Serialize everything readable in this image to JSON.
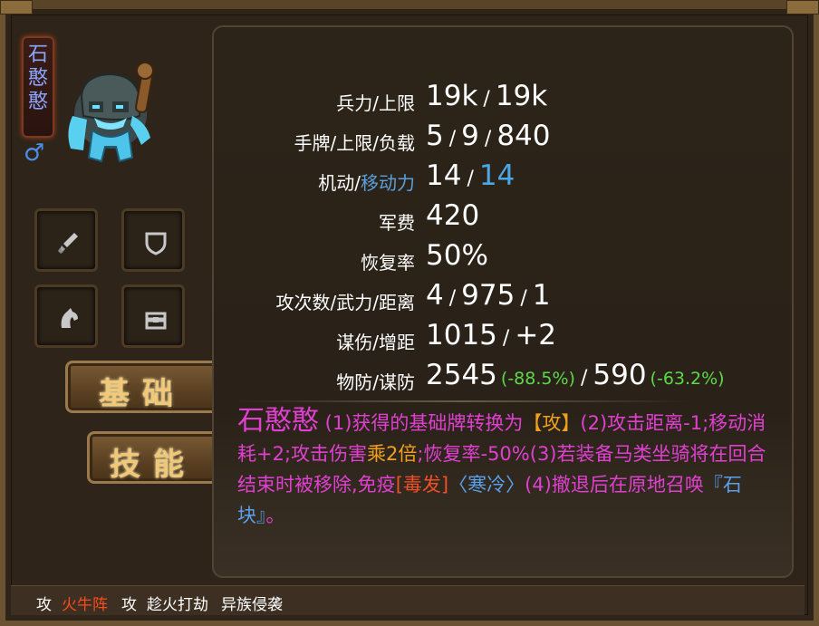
{
  "unit": {
    "name_vertical": "石憨憨",
    "gender_symbol": "♂"
  },
  "tabs": [
    {
      "label": "基础"
    },
    {
      "label": "技能"
    }
  ],
  "stats": [
    {
      "label": "兵力/上限",
      "value": "19k",
      "sep": "/",
      "value2": "19k"
    },
    {
      "label_pre": "手牌/上限/负载",
      "v1": "5",
      "v2": "9",
      "v3": "840"
    },
    {
      "label_a": "机动/",
      "label_b": "移动力",
      "v1": "14",
      "v2": "14"
    },
    {
      "label": "军费",
      "value": "420"
    },
    {
      "label": "恢复率",
      "value": "50%"
    },
    {
      "label": "攻次数/武力/距离",
      "v1": "4",
      "v2": "975",
      "v3": "1"
    },
    {
      "label": "谋伤/增距",
      "v1": "1015",
      "v2": "+2"
    },
    {
      "label": "物防/谋防",
      "v1": "2545",
      "p1": "(-88.5%)",
      "v2": "590",
      "p2": "(-63.2%)"
    }
  ],
  "description": {
    "title": "石憨憨",
    "p1": " (1)获得的基础牌转换为",
    "card": "【攻】",
    "p2": "(2)攻击距离-1;移动消耗+2;攻击伤害",
    "mult": "乘2倍",
    "p3": ";恢复率-50%(3)若装备马类坐骑将在回合结束时被移除,免疫",
    "poison": "[毒发]",
    "cold": "〈寒冷〉",
    "p4": "(4)撤退后在原地召唤",
    "stone": "『石块』",
    "p5": "。"
  },
  "bottom_bar": {
    "t1": "攻",
    "t2": "火牛阵",
    "t3": "攻",
    "t4": "趁火打劫",
    "t5": "异族侵袭"
  },
  "colors": {
    "description": "#e040d0",
    "highlight_orange": "#f0a020",
    "highlight_blue": "#5aa0ec",
    "percent_green": "#5cd84a",
    "bottom_red": "#ff4a1a"
  }
}
